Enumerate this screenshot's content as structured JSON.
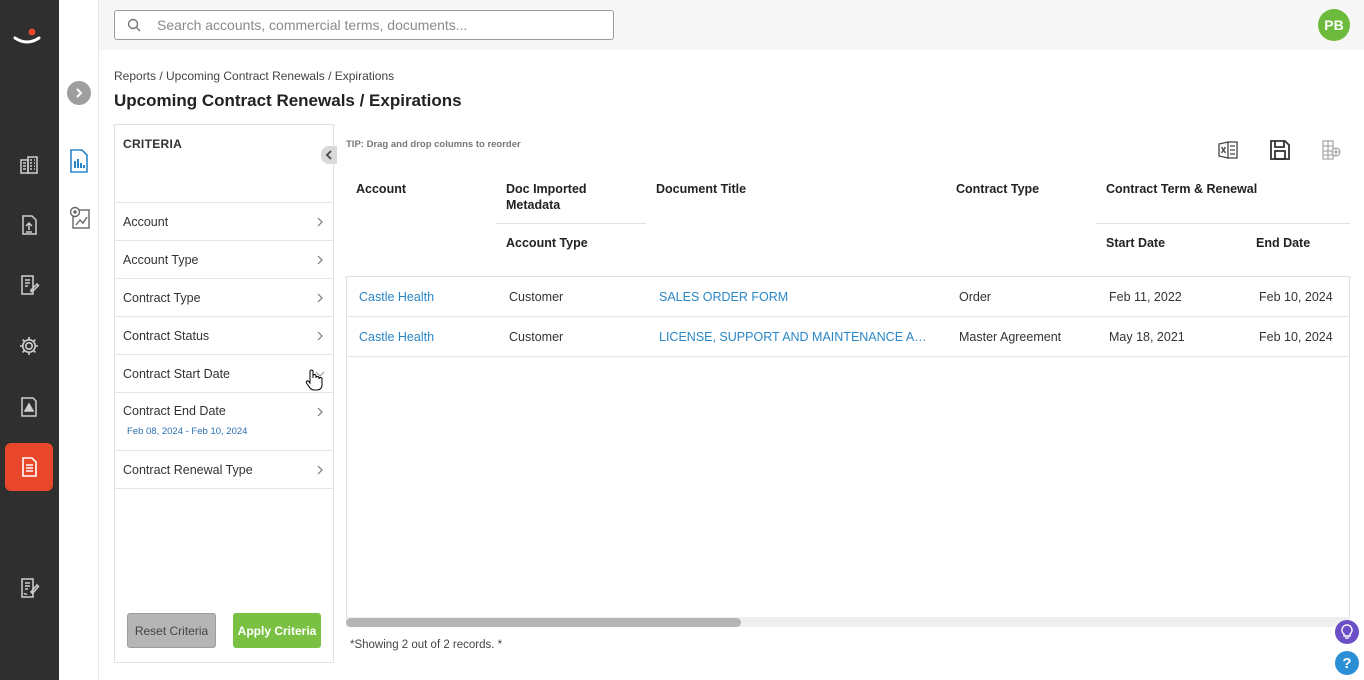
{
  "search": {
    "placeholder": "Search accounts, commercial terms, documents..."
  },
  "user": {
    "initials": "PB"
  },
  "breadcrumb": "Reports / Upcoming Contract Renewals / Expirations",
  "page_title": "Upcoming Contract Renewals / Expirations",
  "criteria": {
    "heading": "CRITERIA",
    "items": [
      {
        "label": "Account",
        "sub": ""
      },
      {
        "label": "Account Type",
        "sub": ""
      },
      {
        "label": "Contract Type",
        "sub": ""
      },
      {
        "label": "Contract Status",
        "sub": ""
      },
      {
        "label": "Contract Start Date",
        "sub": ""
      },
      {
        "label": "Contract End Date",
        "sub": "Feb 08, 2024 - Feb 10, 2024"
      },
      {
        "label": "Contract Renewal Type",
        "sub": ""
      }
    ],
    "reset_label": "Reset Criteria",
    "apply_label": "Apply Criteria"
  },
  "tip": "TIP: Drag and drop columns to reorder",
  "table": {
    "headers": {
      "account": "Account",
      "doc_meta_line1": "Doc Imported",
      "doc_meta_line2": "Metadata",
      "account_type": "Account Type",
      "document_title": "Document Title",
      "contract_type": "Contract Type",
      "contract_term": "Contract Term & Renewal",
      "start_date": "Start Date",
      "end_date": "End Date"
    },
    "rows": [
      {
        "account": "Castle Health",
        "account_type": "Customer",
        "document_title": "SALES ORDER FORM",
        "contract_type": "Order",
        "start_date": "Feb 11, 2022",
        "end_date": "Feb 10, 2024"
      },
      {
        "account": "Castle Health",
        "account_type": "Customer",
        "document_title": "LICENSE, SUPPORT AND MAINTENANCE AGREEMENT",
        "contract_type": "Master Agreement",
        "start_date": "May 18, 2021",
        "end_date": "Feb 10, 2024"
      }
    ]
  },
  "records_text": "*Showing 2 out of 2 records. *",
  "help": {
    "question_label": "?"
  },
  "colors": {
    "accent": "#e8472c",
    "link": "#2a87c7",
    "apply": "#7ac143",
    "avatar": "#6dbb3c"
  }
}
